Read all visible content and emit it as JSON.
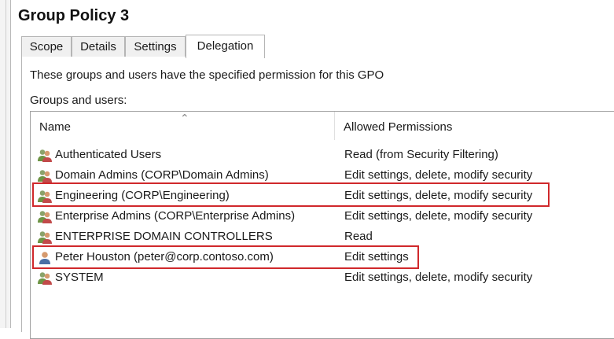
{
  "title": "Group Policy 3",
  "tabs": [
    {
      "label": "Scope"
    },
    {
      "label": "Details"
    },
    {
      "label": "Settings"
    },
    {
      "label": "Delegation",
      "active": true
    }
  ],
  "description": "These groups and users have the specified permission for this GPO",
  "groups_label": "Groups and users:",
  "list": {
    "columns": {
      "name": "Name",
      "permissions": "Allowed Permissions"
    },
    "sort": "ascending-name",
    "rows": [
      {
        "name": "Authenticated Users",
        "permission": "Read (from Security Filtering)",
        "icon": "group-icon",
        "highlighted": false
      },
      {
        "name": "Domain Admins (CORP\\Domain Admins)",
        "permission": "Edit settings, delete, modify security",
        "icon": "group-icon",
        "highlighted": false
      },
      {
        "name": "Engineering (CORP\\Engineering)",
        "permission": "Edit settings, delete, modify security",
        "icon": "group-icon",
        "highlighted": true
      },
      {
        "name": "Enterprise Admins (CORP\\Enterprise Admins)",
        "permission": "Edit settings, delete, modify security",
        "icon": "group-icon",
        "highlighted": false
      },
      {
        "name": "ENTERPRISE DOMAIN CONTROLLERS",
        "permission": "Read",
        "icon": "group-icon",
        "highlighted": false
      },
      {
        "name": "Peter Houston (peter@corp.contoso.com)",
        "permission": "Edit settings",
        "icon": "user-icon",
        "highlighted": true
      },
      {
        "name": "SYSTEM",
        "permission": "Edit settings, delete, modify security",
        "icon": "group-icon",
        "highlighted": false
      }
    ]
  },
  "colors": {
    "highlight": "#d0282b"
  }
}
